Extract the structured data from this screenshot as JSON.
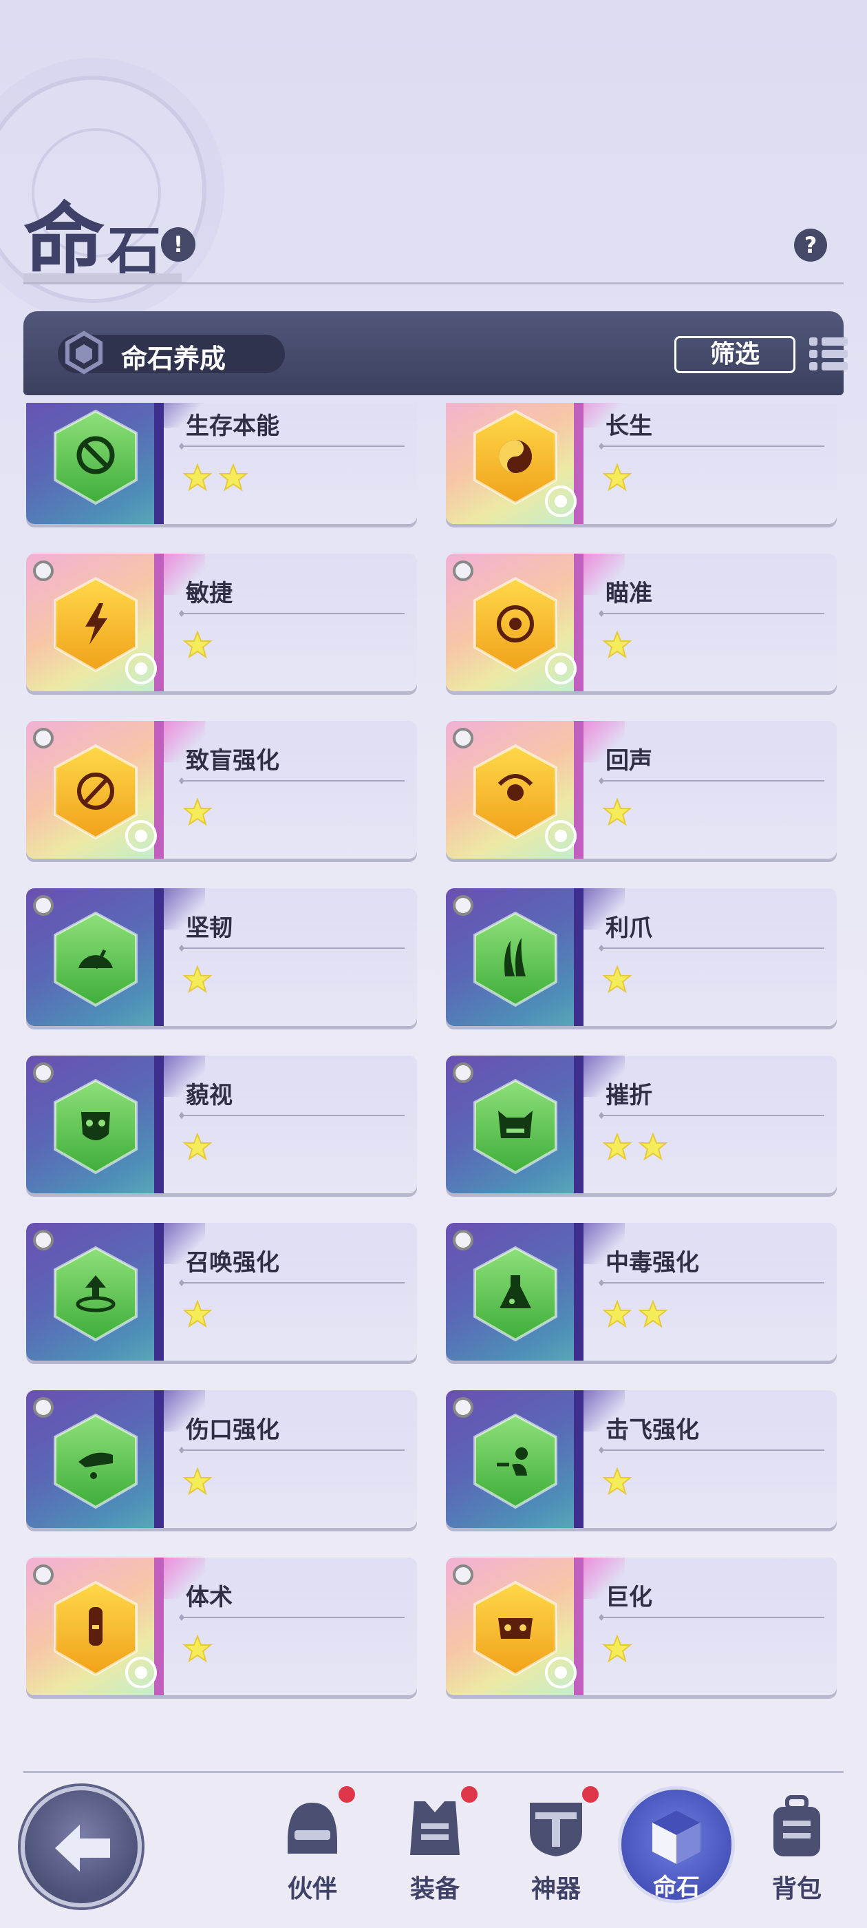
{
  "page": {
    "title_big": "命",
    "title_small": "石",
    "title_info": "!",
    "help": "?"
  },
  "header": {
    "title": "命石养成",
    "filter_label": "筛选"
  },
  "cards": [
    {
      "name": "生存本能",
      "stars": 2,
      "tier": "green",
      "icon": "no-skull-icon",
      "badge": ""
    },
    {
      "name": "长生",
      "stars": 1,
      "tier": "gold",
      "icon": "yin-yang-icon",
      "badge": "skull-crossbones-icon"
    },
    {
      "name": "敏捷",
      "stars": 1,
      "tier": "gold",
      "icon": "lightning-icon",
      "badge": "shield-dagger-icon"
    },
    {
      "name": "瞄准",
      "stars": 1,
      "tier": "gold",
      "icon": "target-icon",
      "badge": "cloud-icon"
    },
    {
      "name": "致盲强化",
      "stars": 1,
      "tier": "gold",
      "icon": "blind-eye-icon",
      "badge": "hand-icon"
    },
    {
      "name": "回声",
      "stars": 1,
      "tier": "gold",
      "icon": "echo-icon",
      "badge": "medic-shield-icon"
    },
    {
      "name": "坚韧",
      "stars": 1,
      "tier": "green",
      "icon": "gauge-icon",
      "badge": ""
    },
    {
      "name": "利爪",
      "stars": 1,
      "tier": "green",
      "icon": "claw-icon",
      "badge": ""
    },
    {
      "name": "藐视",
      "stars": 1,
      "tier": "green",
      "icon": "mask-icon",
      "badge": ""
    },
    {
      "name": "摧折",
      "stars": 2,
      "tier": "green",
      "icon": "demon-face-icon",
      "badge": ""
    },
    {
      "name": "召唤强化",
      "stars": 1,
      "tier": "green",
      "icon": "summon-circle-icon",
      "badge": ""
    },
    {
      "name": "中毒强化",
      "stars": 2,
      "tier": "green",
      "icon": "poison-flask-icon",
      "badge": ""
    },
    {
      "name": "伤口强化",
      "stars": 1,
      "tier": "green",
      "icon": "bleeding-hand-icon",
      "badge": ""
    },
    {
      "name": "击飞强化",
      "stars": 1,
      "tier": "green",
      "icon": "knockback-icon",
      "badge": ""
    },
    {
      "name": "体术",
      "stars": 1,
      "tier": "gold",
      "icon": "vial-icon",
      "badge": "mask-badge-icon"
    },
    {
      "name": "巨化",
      "stars": 1,
      "tier": "gold",
      "icon": "giant-face-icon",
      "badge": "runner-icon"
    },
    {
      "name": "",
      "stars": 0,
      "tier": "gold",
      "icon": "",
      "badge": ""
    },
    {
      "name": "",
      "stars": 0,
      "tier": "gold",
      "icon": "",
      "badge": ""
    }
  ],
  "nav": {
    "items": [
      {
        "label": "伙伴",
        "icon": "helmet-icon",
        "dot": true
      },
      {
        "label": "装备",
        "icon": "armor-vest-icon",
        "dot": true
      },
      {
        "label": "神器",
        "icon": "artifact-icon",
        "dot": true
      },
      {
        "label": "命石",
        "icon": "cube-icon",
        "dot": false,
        "active": true
      },
      {
        "label": "背包",
        "icon": "backpack-icon",
        "dot": false
      }
    ]
  },
  "colors": {
    "accent": "#4450b8",
    "dark": "#3f4168",
    "star": "#f5ec5a",
    "dot": "#e0364a"
  }
}
